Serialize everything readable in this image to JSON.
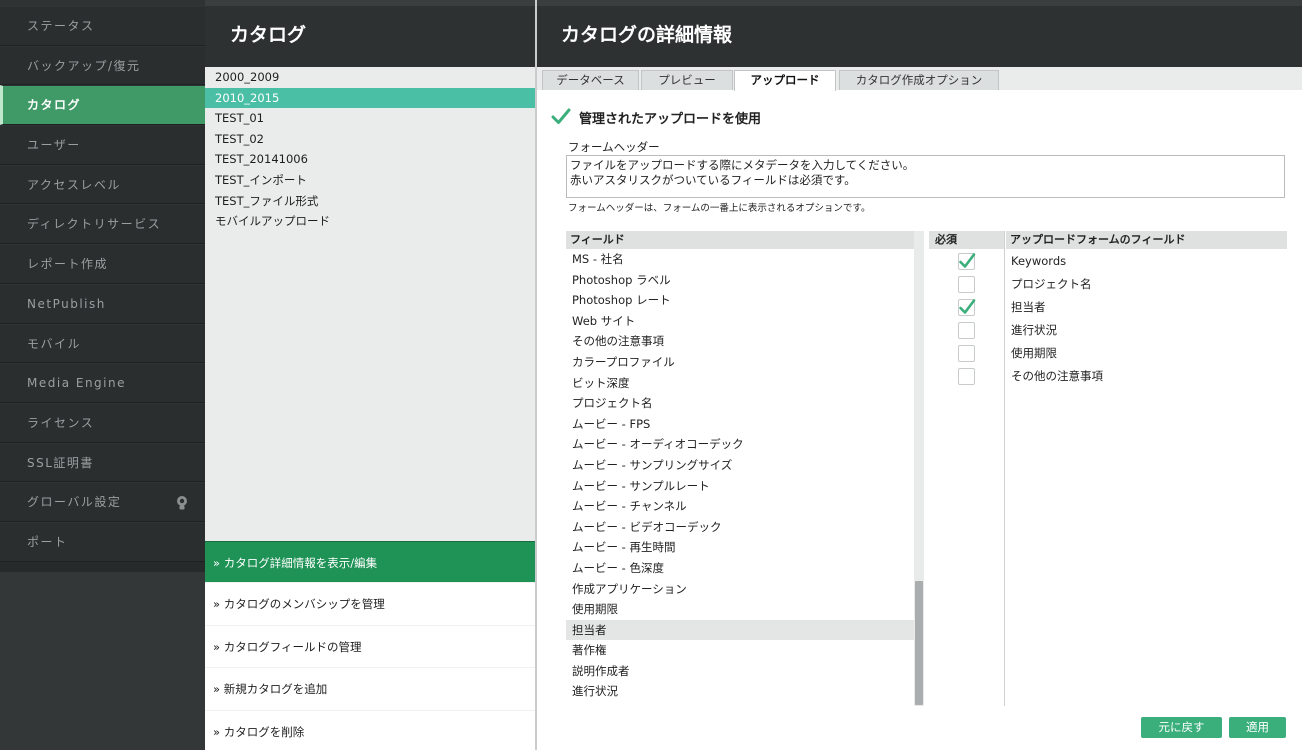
{
  "nav": {
    "items": [
      {
        "label": "ステータス",
        "active": false
      },
      {
        "label": "バックアップ/復元",
        "active": false
      },
      {
        "label": "カタログ",
        "active": true
      },
      {
        "label": "ユーザー",
        "active": false
      },
      {
        "label": "アクセスレベル",
        "active": false
      },
      {
        "label": "ディレクトリサービス",
        "active": false
      },
      {
        "label": "レポート作成",
        "active": false
      },
      {
        "label": "NetPublish",
        "active": false
      },
      {
        "label": "モバイル",
        "active": false
      },
      {
        "label": "Media Engine",
        "active": false
      },
      {
        "label": "ライセンス",
        "active": false
      },
      {
        "label": "SSL証明書",
        "active": false
      },
      {
        "label": "グローバル設定",
        "active": false,
        "icon": "lightbulb-icon"
      },
      {
        "label": "ポート",
        "active": false
      }
    ]
  },
  "catalogs": {
    "title": "カタログ",
    "items": [
      "2000_2009",
      "2010_2015",
      "TEST_01",
      "TEST_02",
      "TEST_20141006",
      "TEST_インポート",
      "TEST_ファイル形式",
      "モバイルアップロード"
    ],
    "selected_index": 1,
    "actions": [
      {
        "label": "» カタログ詳細情報を表示/編集",
        "active": true
      },
      {
        "label": "» カタログのメンバシップを管理",
        "active": false
      },
      {
        "label": "» カタログフィールドの管理",
        "active": false
      },
      {
        "label": "» 新規カタログを追加",
        "active": false
      },
      {
        "label": "» カタログを削除",
        "active": false
      }
    ]
  },
  "details": {
    "title": "カタログの詳細情報",
    "tabs": [
      {
        "label": "データベース",
        "active": false
      },
      {
        "label": "プレビュー",
        "active": false
      },
      {
        "label": "アップロード",
        "active": true
      },
      {
        "label": "カタログ作成オプション",
        "active": false
      }
    ],
    "use_managed_upload": {
      "label": "管理されたアップロードを使用",
      "checked": true
    },
    "form_header": {
      "label": "フォームヘッダー",
      "value": "ファイルをアップロードする際にメタデータを入力してください。\n赤いアスタリスクがついているフィールドは必須です。",
      "help": "フォームヘッダーは、フォームの一番上に表示されるオプションです。"
    },
    "fields": {
      "header": "フィールド",
      "items": [
        "MS - 社名",
        "Photoshop ラベル",
        "Photoshop レート",
        "Web サイト",
        "その他の注意事項",
        "カラープロファイル",
        "ビット深度",
        "プロジェクト名",
        "ムービー - FPS",
        "ムービー - オーディオコーデック",
        "ムービー - サンプリングサイズ",
        "ムービー - サンプルレート",
        "ムービー - チャンネル",
        "ムービー - ビデオコーデック",
        "ムービー - 再生時間",
        "ムービー - 色深度",
        "作成アプリケーション",
        "使用期限",
        "担当者",
        "著作権",
        "説明作成者",
        "進行状況"
      ],
      "selected_index": 18
    },
    "required": {
      "header": "必須",
      "values": [
        true,
        false,
        true,
        false,
        false,
        false
      ]
    },
    "upload_fields": {
      "header": "アップロードフォームのフィールド",
      "items": [
        "Keywords",
        "プロジェクト名",
        "担当者",
        "進行状況",
        "使用期限",
        "その他の注意事項"
      ]
    },
    "buttons": {
      "revert": "元に戻す",
      "apply": "適用"
    }
  },
  "colors": {
    "nav_bg": "#262a2b",
    "nav_active": "#3f9a67",
    "catalog_selected": "#4bbfa6",
    "action_active": "#1f9256",
    "check_green": "#3aaf7c",
    "button_green": "#3aaf7c"
  }
}
